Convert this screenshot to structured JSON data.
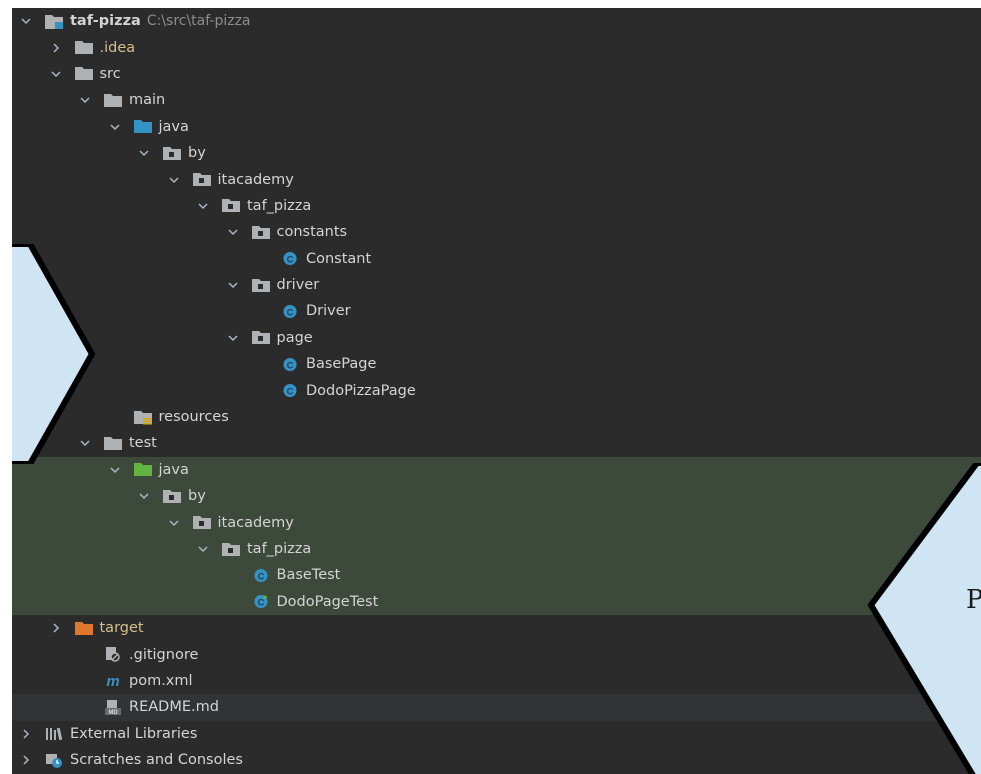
{
  "project": {
    "name": "taf-pizza",
    "path": "C:\\src\\taf-pizza"
  },
  "tree": [
    {
      "label": ".idea",
      "depth": 1,
      "expanded": false,
      "icon": "folder-gray-icon",
      "style": "idea"
    },
    {
      "label": "src",
      "depth": 1,
      "expanded": true,
      "icon": "folder-gray-icon"
    },
    {
      "label": "main",
      "depth": 2,
      "expanded": true,
      "icon": "folder-gray-icon"
    },
    {
      "label": "java",
      "depth": 3,
      "expanded": true,
      "icon": "folder-blue-icon"
    },
    {
      "label": "by",
      "depth": 4,
      "expanded": true,
      "icon": "package-icon"
    },
    {
      "label": "itacademy",
      "depth": 5,
      "expanded": true,
      "icon": "package-icon"
    },
    {
      "label": "taf_pizza",
      "depth": 6,
      "expanded": true,
      "icon": "package-icon"
    },
    {
      "label": "constants",
      "depth": 7,
      "expanded": true,
      "icon": "package-icon"
    },
    {
      "label": "Constant",
      "depth": 8,
      "expanded": null,
      "icon": "class-icon"
    },
    {
      "label": "driver",
      "depth": 7,
      "expanded": true,
      "icon": "package-icon"
    },
    {
      "label": "Driver",
      "depth": 8,
      "expanded": null,
      "icon": "class-icon"
    },
    {
      "label": "page",
      "depth": 7,
      "expanded": true,
      "icon": "package-icon"
    },
    {
      "label": "BasePage",
      "depth": 8,
      "expanded": null,
      "icon": "class-icon"
    },
    {
      "label": "DodoPizzaPage",
      "depth": 8,
      "expanded": null,
      "icon": "class-icon"
    },
    {
      "label": "resources",
      "depth": 3,
      "expanded": null,
      "icon": "resources-folder-icon"
    },
    {
      "label": "test",
      "depth": 2,
      "expanded": true,
      "icon": "folder-gray-icon"
    },
    {
      "label": "java",
      "depth": 3,
      "expanded": true,
      "icon": "folder-green-icon",
      "highlight": true
    },
    {
      "label": "by",
      "depth": 4,
      "expanded": true,
      "icon": "package-icon",
      "highlight": true
    },
    {
      "label": "itacademy",
      "depth": 5,
      "expanded": true,
      "icon": "package-icon",
      "highlight": true
    },
    {
      "label": "taf_pizza",
      "depth": 6,
      "expanded": true,
      "icon": "package-icon",
      "highlight": true
    },
    {
      "label": "BaseTest",
      "depth": 7,
      "expanded": null,
      "icon": "class-icon",
      "highlight": true
    },
    {
      "label": "DodoPageTest",
      "depth": 7,
      "expanded": null,
      "icon": "test-class-icon",
      "highlight": true
    },
    {
      "label": "target",
      "depth": 1,
      "expanded": false,
      "icon": "folder-orange-icon",
      "style": "target"
    },
    {
      "label": ".gitignore",
      "depth": 2,
      "expanded": null,
      "icon": "gitignore-icon"
    },
    {
      "label": "pom.xml",
      "depth": 2,
      "expanded": null,
      "icon": "maven-icon"
    },
    {
      "label": "README.md",
      "depth": 2,
      "expanded": null,
      "icon": "markdown-icon",
      "selected": true
    },
    {
      "label": "External Libraries",
      "depth": 0,
      "expanded": false,
      "icon": "libraries-icon"
    },
    {
      "label": "Scratches and Consoles",
      "depth": 0,
      "expanded": false,
      "icon": "scratches-icon"
    }
  ],
  "callout": {
    "text": "P"
  },
  "colors": {
    "background": "#2b2b2b",
    "highlight_row": "#3d4a3b",
    "class_icon": "#3592c4",
    "folder_blue": "#3592c4",
    "folder_green": "#62b543",
    "folder_orange": "#e0782c",
    "folder_gray": "#afb1b3",
    "callout_fill": "#cfe5f3"
  }
}
